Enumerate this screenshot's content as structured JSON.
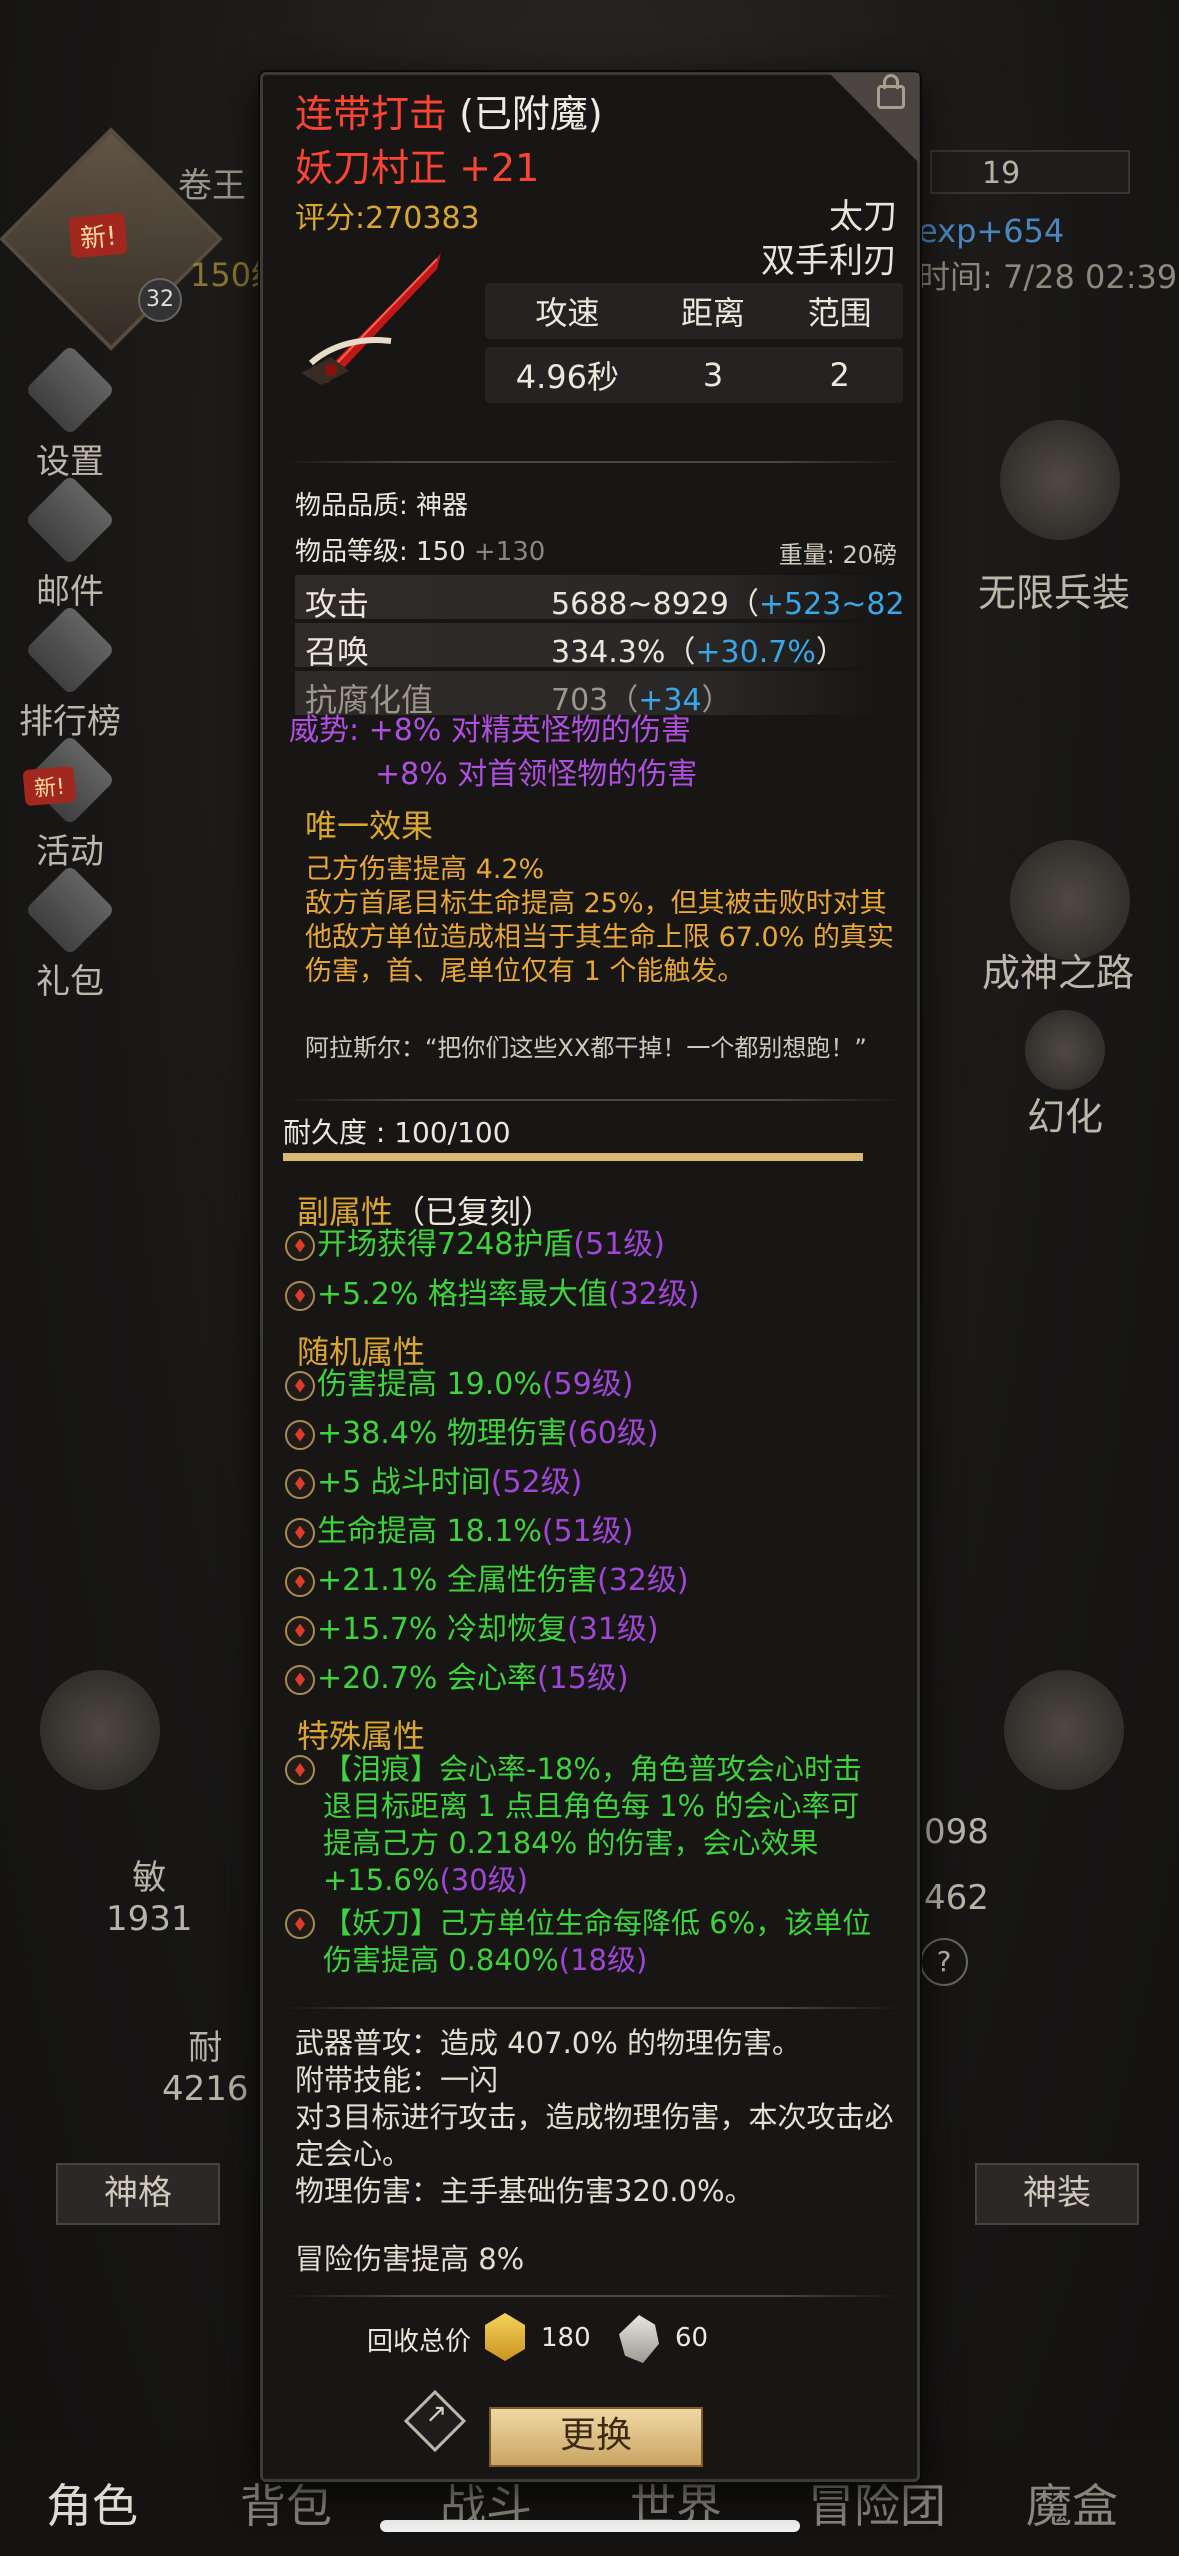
{
  "background": {
    "player_name": "卷王",
    "new_badge": "新!",
    "level_badge": "32",
    "level_text": "150级",
    "resource_count": "19",
    "exp_text": "exp+654",
    "time_text": "时间: 7/28 02:39",
    "left_menu": [
      "设置",
      "邮件",
      "排行榜",
      "活动",
      "礼包"
    ],
    "activity_new_badge": "新!",
    "right_menu": [
      "无限兵装",
      "成神之路",
      "幻化"
    ],
    "stat_agi_label": "敏",
    "stat_agi_value": "1931",
    "stat_end_label": "耐",
    "stat_end_value": "4216",
    "stat_right1": "098",
    "stat_right2": "462",
    "help_icon": "?",
    "pill_left": "神格",
    "pill_right": "神装",
    "bottom_tabs": [
      "角色",
      "背包",
      "战斗",
      "世界",
      "冒险团",
      "魔盒"
    ]
  },
  "item": {
    "enchant_name": "连带打击",
    "enchant_suffix": " (已附魔)",
    "name": "妖刀村正 +21",
    "score": "评分:270383",
    "weapon_type": "太刀",
    "hand_type": "双手利刃",
    "spec_headers": [
      "攻速",
      "距离",
      "范围"
    ],
    "spec_values": [
      "4.96秒",
      "3",
      "2"
    ],
    "quality": "物品品质: 神器",
    "item_level_label": "物品等级: 150",
    "item_level_bonus": " +130",
    "weight": "重量: 20磅",
    "attrs": [
      {
        "k": "攻击",
        "v": "5688~8929（",
        "bonus": "+523~82"
      },
      {
        "k": "召唤",
        "v": "334.3%（",
        "bonus": "+30.7%",
        "tail": "）"
      },
      {
        "k": "抗腐化值",
        "v": "703（",
        "bonus": "+34",
        "tail": "）"
      }
    ],
    "prestige_1": "威势: +8% 对精英怪物的伤害",
    "prestige_2": "+8% 对首领怪物的伤害",
    "unique_title": "唯一效果",
    "unique_body": "己方伤害提高 4.2%\n敌方首尾目标生命提高 25%，但其被击败时对其他敌方单位造成相当于其生命上限 67.0% 的真实伤害，首、尾单位仅有 1 个能触发。",
    "quote": "阿拉斯尔：“把你们这些XX都干掉！一个都别想跑！”",
    "durability": "耐久度 : 100/100",
    "durability_fraction": 1.0,
    "sub_title": "副属性",
    "sub_title_suffix": "（已复刻）",
    "sub_affixes": [
      {
        "t": "开场获得7248护盾",
        "l": "(51级)"
      },
      {
        "t": "+5.2% 格挡率最大值",
        "l": "(32级)"
      }
    ],
    "random_title": "随机属性",
    "random_affixes": [
      {
        "t": "伤害提高 19.0%",
        "l": "(59级)"
      },
      {
        "t": "+38.4% 物理伤害",
        "l": "(60级)"
      },
      {
        "t": "+5 战斗时间",
        "l": "(52级)"
      },
      {
        "t": "生命提高 18.1%",
        "l": "(51级)"
      },
      {
        "t": "+21.1% 全属性伤害",
        "l": "(32级)"
      },
      {
        "t": "+15.7% 冷却恢复",
        "l": "(31级)"
      },
      {
        "t": "+20.7% 会心率",
        "l": "(15级)"
      }
    ],
    "special_title": "特殊属性",
    "special_1": "【泪痕】会心率-18%，角色普攻会心时击退目标距离 1 点且角色每 1% 的会心率可提高己方 0.2184% 的伤害，会心效果+15.6%",
    "special_1_lvl": "(30级)",
    "special_2": "【妖刀】己方单位生命每降低 6%，该单位伤害提高 0.840%",
    "special_2_lvl": "(18级)",
    "skill_text": "武器普攻：造成 407.0% 的物理伤害。\n附带技能：一闪\n对3目标进行攻击，造成物理伤害，本次攻击必定会心。\n物理伤害：主手基础伤害320.0%。",
    "adventure_bonus": "冒险伤害提高 8%",
    "recycle_label": "回收总价",
    "recycle_gold": "180",
    "recycle_silver": "60",
    "swap_button": "更换"
  }
}
